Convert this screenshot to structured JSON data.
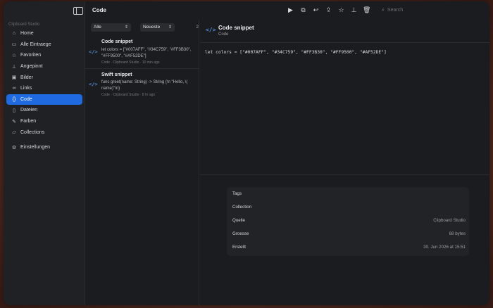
{
  "app": {
    "name": "Clipboard Studio"
  },
  "sidebar": {
    "section_label": "Clipboard Studio",
    "items": [
      {
        "label": "Home",
        "icon": "house-icon"
      },
      {
        "label": "Alle Eintraege",
        "icon": "tray-icon"
      },
      {
        "label": "Favoriten",
        "icon": "star-icon"
      },
      {
        "label": "Angepinnt",
        "icon": "pin-icon"
      },
      {
        "label": "Bilder",
        "icon": "photo-icon"
      },
      {
        "label": "Links",
        "icon": "link-icon"
      },
      {
        "label": "Code",
        "icon": "braces-icon",
        "active": true
      },
      {
        "label": "Dateien",
        "icon": "doc-icon"
      },
      {
        "label": "Farben",
        "icon": "eyedropper-icon"
      },
      {
        "label": "Collections",
        "icon": "folder-icon"
      }
    ],
    "settings": {
      "label": "Einstellungen",
      "icon": "gear-icon"
    }
  },
  "header": {
    "title": "Code",
    "tools": [
      "play-icon",
      "copy-icon",
      "return-icon",
      "share-icon",
      "star-icon",
      "pin-icon",
      "trash-icon"
    ],
    "search_placeholder": "Search"
  },
  "list": {
    "filter_type": "Alle",
    "filter_sort": "Neueste",
    "count": "2",
    "items": [
      {
        "title": "Code snippet",
        "body_line1": "let colors = [\"#007AFF\", \"#34C759\", \"#FF3B30\",",
        "body_line2": "\"#FF9500\", \"#AF52DE\"]",
        "meta": "Code · Clipboard Studio · 10 min ago"
      },
      {
        "title": "Swift snippet",
        "body_line1": "func greet(name: String) -> String {\\n    \"Hello, \\(",
        "body_line2": "name)\"\\n}",
        "meta": "Code · Clipboard Studio · 8 hr ago"
      }
    ]
  },
  "detail": {
    "title": "Code snippet",
    "subtitle": "Code",
    "code": "let colors = [\"#007AFF\", \"#34C759\", \"#FF3B30\", \"#FF9500\", \"#AF52DE\"]",
    "meta": [
      {
        "key": "Tags",
        "value": ""
      },
      {
        "key": "Collection",
        "value": ""
      },
      {
        "key": "Quelle",
        "value": "Clipboard Studio"
      },
      {
        "key": "Groesse",
        "value": "68 bytes"
      },
      {
        "key": "Erstellt",
        "value": "30. Jun 2026 at 15:51"
      }
    ]
  },
  "colors": {
    "accent": "#1F6AE0",
    "code_icon": "#5AA4FF",
    "window_bg": "#1B1C1F"
  }
}
